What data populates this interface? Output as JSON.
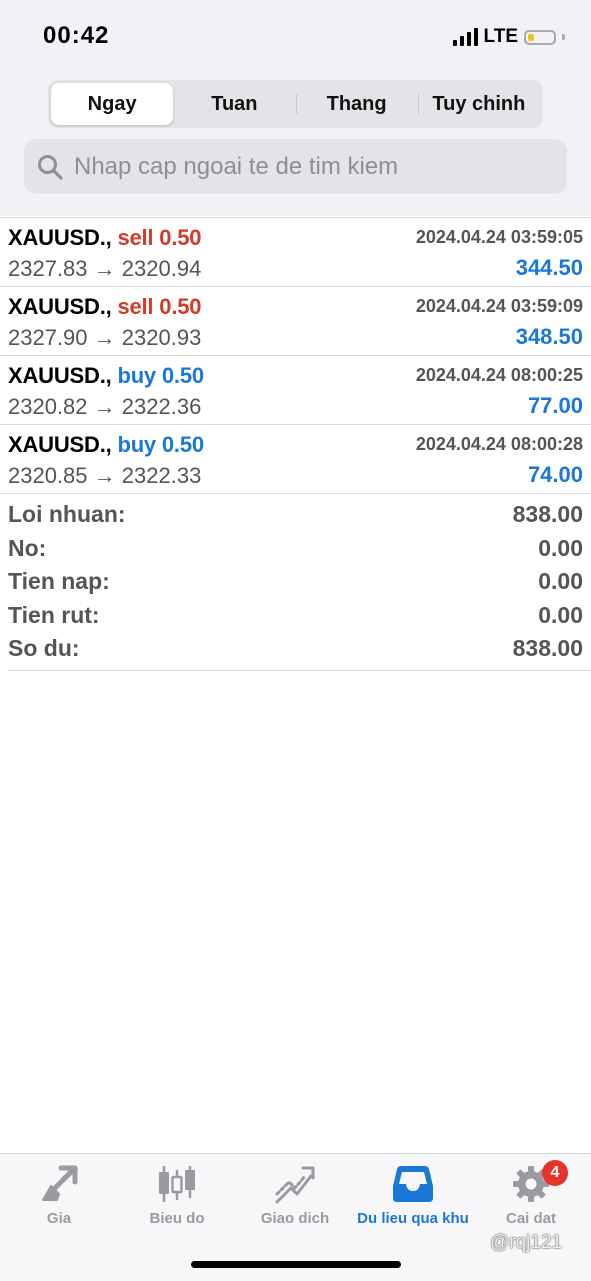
{
  "status_bar": {
    "time": "00:42",
    "network": "LTE",
    "battery_level": 0.25
  },
  "period_tabs": [
    {
      "label": "Ngay",
      "active": true
    },
    {
      "label": "Tuan",
      "active": false
    },
    {
      "label": "Thang",
      "active": false
    },
    {
      "label": "Tuy chinh",
      "active": false
    }
  ],
  "search": {
    "placeholder": "Nhap cap ngoai te de tim kiem",
    "value": ""
  },
  "trades": [
    {
      "symbol": "XAUUSD.,",
      "type": "sell",
      "volume": "0.50",
      "time": "2024.04.24 03:59:05",
      "open": "2327.83",
      "close": "2320.94",
      "arrow": "→",
      "profit": "344.50"
    },
    {
      "symbol": "XAUUSD.,",
      "type": "sell",
      "volume": "0.50",
      "time": "2024.04.24 03:59:09",
      "open": "2327.90",
      "close": "2320.93",
      "arrow": "→",
      "profit": "348.50"
    },
    {
      "symbol": "XAUUSD.,",
      "type": "buy",
      "volume": "0.50",
      "time": "2024.04.24 08:00:25",
      "open": "2320.82",
      "close": "2322.36",
      "arrow": "→",
      "profit": "77.00"
    },
    {
      "symbol": "XAUUSD.,",
      "type": "buy",
      "volume": "0.50",
      "time": "2024.04.24 08:00:28",
      "open": "2320.85",
      "close": "2322.33",
      "arrow": "→",
      "profit": "74.00"
    }
  ],
  "summary": [
    {
      "label": "Loi nhuan:",
      "value": "838.00"
    },
    {
      "label": "No:",
      "value": "0.00"
    },
    {
      "label": "Tien nap:",
      "value": "0.00"
    },
    {
      "label": "Tien rut:",
      "value": "0.00"
    },
    {
      "label": "So du:",
      "value": "838.00"
    }
  ],
  "tab_bar": [
    {
      "label": "Gia",
      "icon": "price-arrows-icon",
      "active": false
    },
    {
      "label": "Bieu do",
      "icon": "candlestick-icon",
      "active": false
    },
    {
      "label": "Giao dich",
      "icon": "trend-icon",
      "active": false
    },
    {
      "label": "Du lieu qua khu",
      "icon": "history-inbox-icon",
      "active": true
    },
    {
      "label": "Cai dat",
      "icon": "gear-icon",
      "active": false,
      "badge": "4"
    }
  ],
  "watermark": "@rqj121",
  "colors": {
    "sell": "#d23a2a",
    "buy": "#1b78d6",
    "profit": "#1b78d6",
    "active_tab": "#1b78d6",
    "badge": "#e8332a"
  }
}
